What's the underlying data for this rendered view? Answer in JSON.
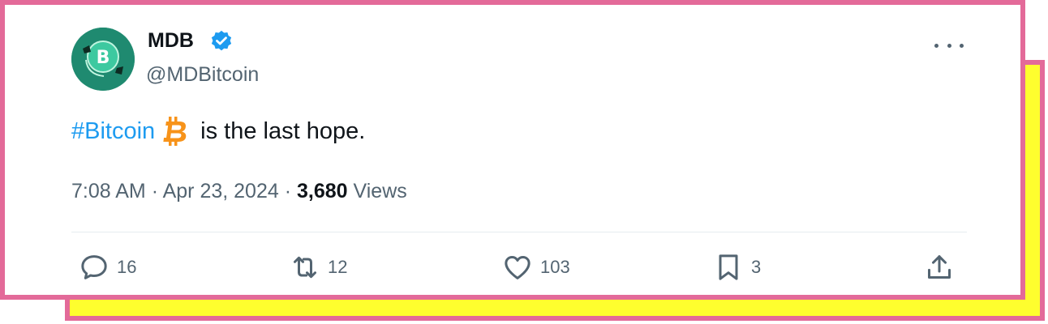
{
  "author": {
    "name": "MDB",
    "handle": "@MDBitcoin",
    "verified": true
  },
  "tweet": {
    "hashtag": "#Bitcoin",
    "text": "is the last hope.",
    "emoji": "bitcoin-logo"
  },
  "meta": {
    "time": "7:08 AM",
    "separator": "·",
    "date": "Apr 23, 2024",
    "views_count": "3,680",
    "views_label": "Views"
  },
  "actions": {
    "replies": "16",
    "reposts": "12",
    "likes": "103",
    "bookmarks": "3"
  },
  "colors": {
    "frame_pink": "#e36a99",
    "backdrop_yellow": "#fefe2e",
    "link_blue": "#1d9bf0",
    "secondary_text": "#536471",
    "avatar_green": "#1f8a70",
    "bitcoin_orange": "#f7931a"
  }
}
